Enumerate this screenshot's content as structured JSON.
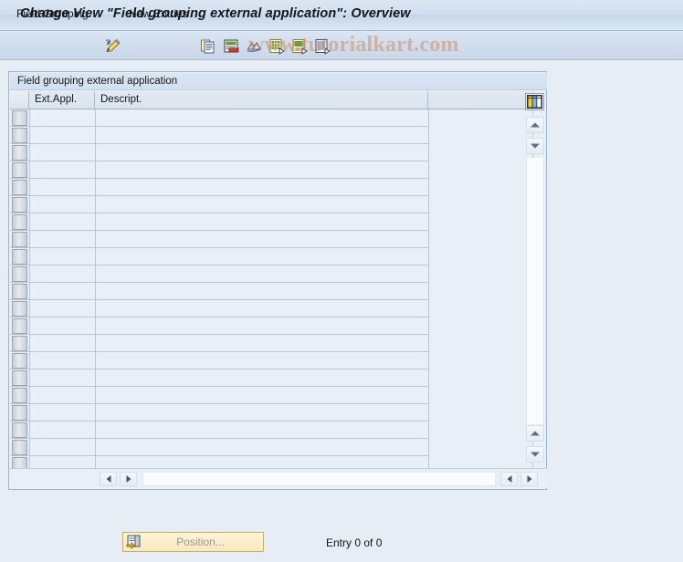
{
  "window": {
    "title": "Change View \"Field grouping external application\": Overview"
  },
  "toolbar": {
    "menu_label": "Field Grouping",
    "new_entries_label": "New Entries",
    "icons": [
      {
        "name": "display-change-pencil-icon",
        "tooltip": "Display/Change"
      },
      {
        "name": "copy-as-icon",
        "tooltip": "Copy As..."
      },
      {
        "name": "delete-row-icon",
        "tooltip": "Delete"
      },
      {
        "name": "undo-icon",
        "tooltip": "Undo Change"
      },
      {
        "name": "select-all-icon",
        "tooltip": "Select All"
      },
      {
        "name": "select-block-icon",
        "tooltip": "Select Block"
      },
      {
        "name": "deselect-all-icon",
        "tooltip": "Deselect All"
      }
    ]
  },
  "watermark": {
    "text": "www.tutorialkart.com",
    "color": "#cc743c"
  },
  "panel": {
    "title": "Field grouping external application"
  },
  "table": {
    "columns": [
      {
        "key": "ext_appl",
        "label": "Ext.Appl."
      },
      {
        "key": "descript",
        "label": "Descript."
      }
    ],
    "rows": [],
    "empty_row_count": 21,
    "column_config_icon": "column-configuration-icon"
  },
  "scrollbars": {
    "vertical_up_icon": "scroll-up-icon",
    "vertical_down_icon": "scroll-down-icon",
    "horizontal_left_icon": "scroll-left-icon",
    "horizontal_right_icon": "scroll-right-icon"
  },
  "footer": {
    "position_button_label": "Position...",
    "position_button_icon": "position-icon",
    "entry_status": "Entry 0 of 0"
  },
  "colors": {
    "background": "#e6edf5",
    "title_bar": "#cfdeee",
    "accent_border": "#9db5cc",
    "button_yellow": "#f7e9bf"
  }
}
